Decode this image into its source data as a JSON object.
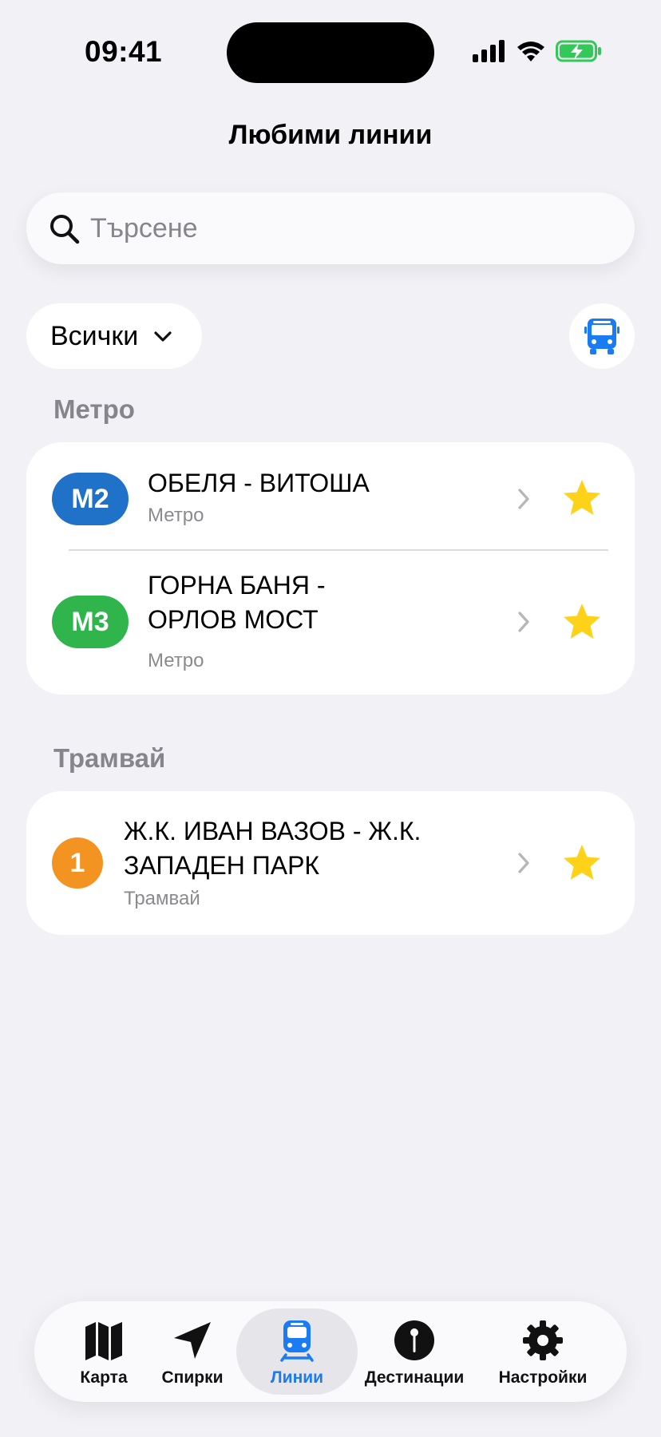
{
  "status_bar": {
    "time": "09:41"
  },
  "header": {
    "title": "Любими линии"
  },
  "search": {
    "placeholder": "Търсене",
    "value": ""
  },
  "filter": {
    "label": "Всички"
  },
  "colors": {
    "accent": "#1a7bf2",
    "metro_m2": "#1f72c7",
    "metro_m3": "#2fb54c",
    "tram": "#f39321",
    "star": "#ffd21a"
  },
  "sections": [
    {
      "title": "Метро",
      "items": [
        {
          "badge": "M2",
          "title_line1": "ОБЕЛЯ - ВИТОША",
          "title_line2": "",
          "subtitle": "Метро",
          "favorite": true
        },
        {
          "badge": "M3",
          "title_line1": "ГОРНА БАНЯ -",
          "title_line2": "ОРЛОВ МОСТ",
          "subtitle": "Метро",
          "favorite": true
        }
      ]
    },
    {
      "title": "Трамвай",
      "items": [
        {
          "badge": "1",
          "title_line1": "Ж.К. ИВАН ВАЗОВ - Ж.К.",
          "title_line2": "ЗАПАДЕН ПАРК",
          "subtitle": "Трамвай",
          "favorite": true
        }
      ]
    }
  ],
  "tabbar": {
    "active": "Линии",
    "tabs": [
      {
        "label": "Карта",
        "icon": "map-icon"
      },
      {
        "label": "Спирки",
        "icon": "location-arrow-icon"
      },
      {
        "label": "Линии",
        "icon": "tram-icon"
      },
      {
        "label": "Дестинации",
        "icon": "pin-icon"
      },
      {
        "label": "Настройки",
        "icon": "gear-icon"
      }
    ]
  }
}
